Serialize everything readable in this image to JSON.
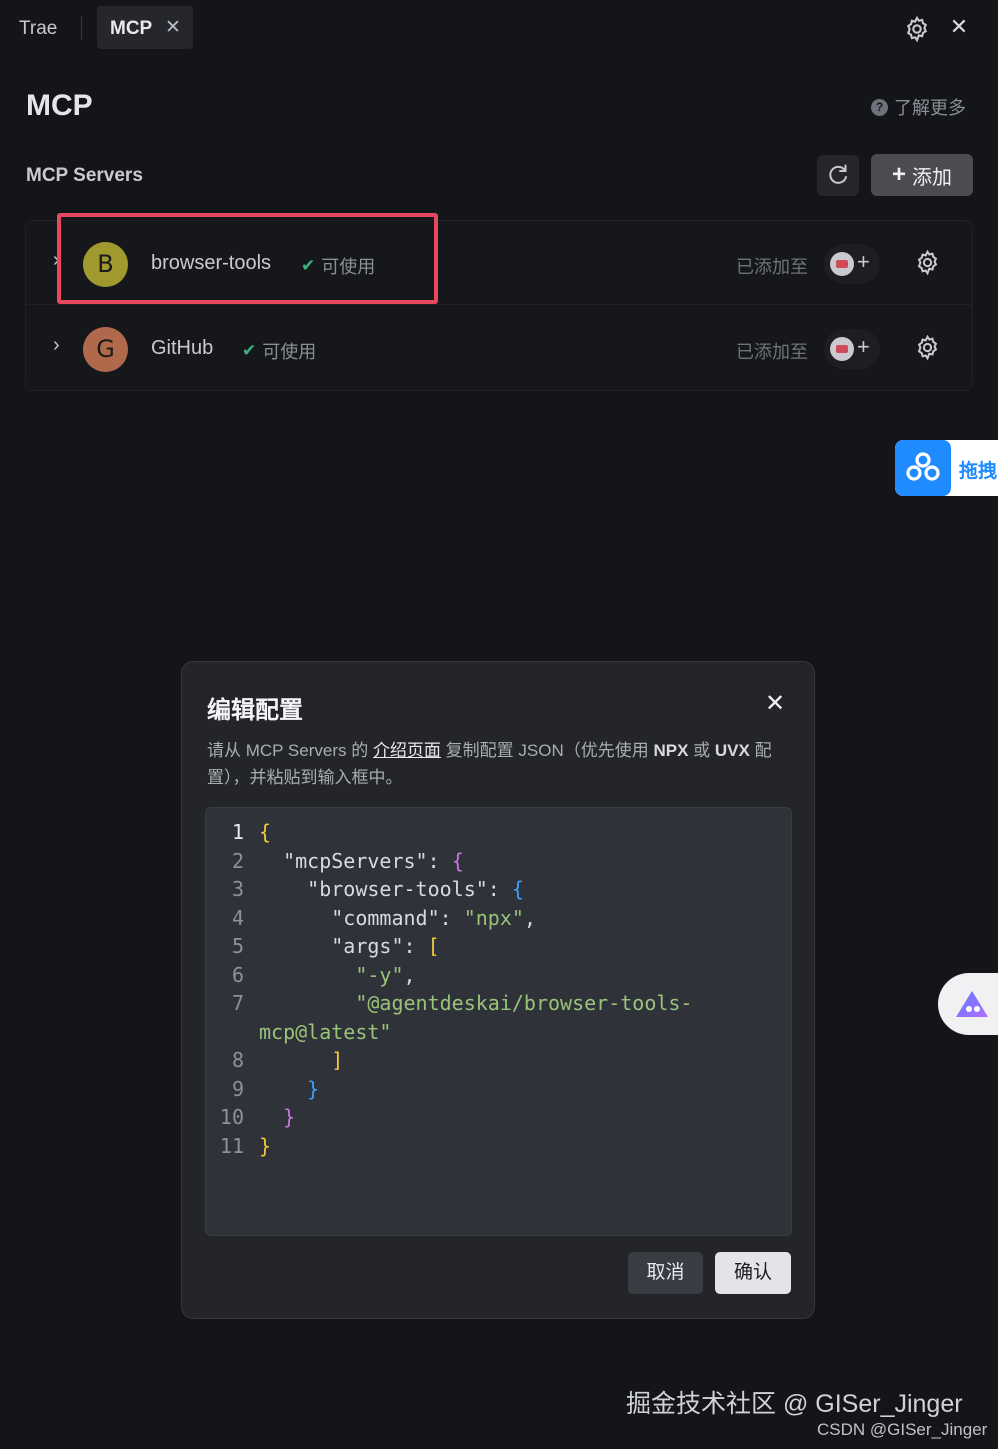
{
  "tabs": {
    "app_label": "Trae",
    "active_tab": "MCP",
    "close_glyph": "✕"
  },
  "window": {
    "close_glyph": "✕"
  },
  "header": {
    "title": "MCP",
    "learn_more": "了解更多",
    "help_glyph": "?"
  },
  "servers_section": {
    "title": "MCP Servers",
    "add_label": "添加",
    "add_glyph": "+"
  },
  "servers": [
    {
      "name": "browser-tools",
      "avatar_letter": "B",
      "avatar_color": "#a09a2e",
      "status": "可使用",
      "added_to": "已添加至",
      "highlighted": true
    },
    {
      "name": "GitHub",
      "avatar_letter": "G",
      "avatar_color": "#b0694a",
      "status": "可使用",
      "added_to": "已添加至",
      "highlighted": false
    }
  ],
  "floating": {
    "baidu_text": "拖拽"
  },
  "modal": {
    "title": "编辑配置",
    "close_glyph": "✕",
    "desc_prefix": "请从 MCP Servers 的 ",
    "desc_link": "介绍页面",
    "desc_mid": " 复制配置 JSON（优先使用 ",
    "desc_npx": "NPX",
    "desc_or": " 或 ",
    "desc_uvx": "UVX",
    "desc_suffix": " 配置），并粘贴到输入框中。",
    "cancel_label": "取消",
    "confirm_label": "确认",
    "code_lines": [
      {
        "n": "1",
        "text": "{"
      },
      {
        "n": "2",
        "text": "  \"mcpServers\": {"
      },
      {
        "n": "3",
        "text": "    \"browser-tools\": {"
      },
      {
        "n": "4",
        "text": "      \"command\": \"npx\","
      },
      {
        "n": "5",
        "text": "      \"args\": ["
      },
      {
        "n": "6",
        "text": "        \"-y\","
      },
      {
        "n": "7",
        "text": "        \"@agentdeskai/browser-tools-"
      },
      {
        "n": "",
        "text": "mcp@latest\""
      },
      {
        "n": "8",
        "text": "      ]"
      },
      {
        "n": "9",
        "text": "    }"
      },
      {
        "n": "10",
        "text": "  }"
      },
      {
        "n": "11",
        "text": "}"
      }
    ]
  },
  "watermark": {
    "line1": "掘金技术社区 @ GISer_Jinger",
    "line2": "CSDN @GISer_Jinger"
  },
  "colors": {
    "highlight_border": "#e6495d",
    "status_check": "#3fb27f",
    "string_green": "#98c379",
    "brace_yellow": "#f2c83a",
    "brace_purple": "#c678dd",
    "brace_blue": "#3aa0ff"
  }
}
